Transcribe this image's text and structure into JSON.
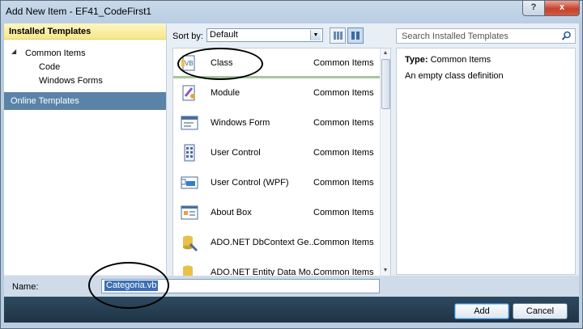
{
  "window": {
    "title": "Add New Item - EF41_CodeFirst1",
    "help_label": "?",
    "close_label": "x"
  },
  "left_panel": {
    "installed_header": "Installed Templates",
    "tree": [
      {
        "label": "Common Items",
        "expanded": true
      },
      {
        "label": "Code"
      },
      {
        "label": "Windows Forms"
      }
    ],
    "online": "Online Templates"
  },
  "sortbar": {
    "label": "Sort by:",
    "selected": "Default"
  },
  "templates": [
    {
      "name": "Class",
      "category": "Common Items",
      "icon": "vb-class-icon",
      "selected": true
    },
    {
      "name": "Module",
      "category": "Common Items",
      "icon": "module-icon"
    },
    {
      "name": "Windows Form",
      "category": "Common Items",
      "icon": "windows-form-icon"
    },
    {
      "name": "User Control",
      "category": "Common Items",
      "icon": "user-control-icon"
    },
    {
      "name": "User Control (WPF)",
      "category": "Common Items",
      "icon": "wpf-user-control-icon"
    },
    {
      "name": "About Box",
      "category": "Common Items",
      "icon": "about-box-icon"
    },
    {
      "name": "ADO.NET DbContext Ge...",
      "category": "Common Items",
      "icon": "ado-dbcontext-icon"
    },
    {
      "name": "ADO.NET Entity Data Mo...",
      "category": "Common Items",
      "icon": "ado-entity-icon"
    }
  ],
  "search": {
    "placeholder": "Search Installed Templates"
  },
  "details": {
    "type_label": "Type:",
    "type_value": "Common Items",
    "description": "An empty class definition"
  },
  "name_row": {
    "label": "Name:",
    "value": "Categoria.vb"
  },
  "buttons": {
    "add": "Add",
    "cancel": "Cancel"
  },
  "colors": {
    "selection": "#5b83a8",
    "header_bg": "#f7e68a",
    "footer": "#1f3445"
  }
}
